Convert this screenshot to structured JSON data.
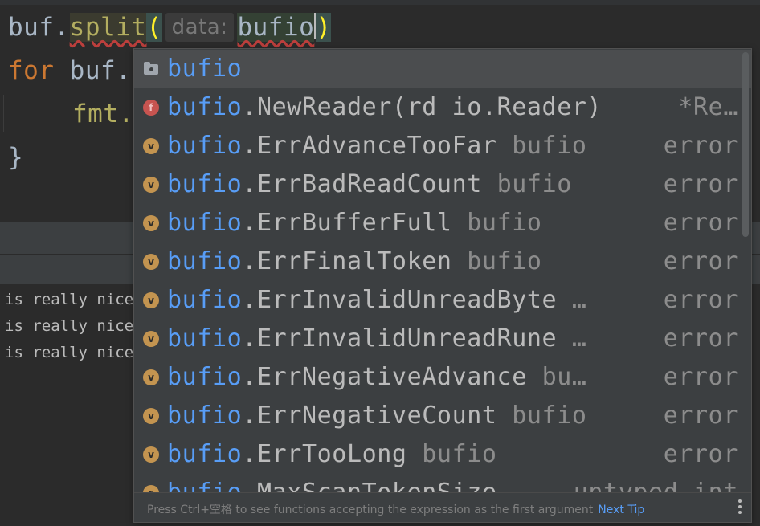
{
  "editor": {
    "line1": {
      "obj": "buf.",
      "method": "split",
      "open_paren": "(",
      "hint": "data:",
      "typed": "bufio",
      "close_paren": ")"
    },
    "line2": {
      "keyword": "for",
      "rest": " buf."
    },
    "line3": {
      "rest": "fmt."
    },
    "line4": {
      "brace": "}"
    }
  },
  "console": {
    "lines": [
      "is really nice",
      "is really nice",
      "is really nice"
    ]
  },
  "completion": {
    "items": [
      {
        "icon": "package-icon",
        "prefix": "bufio",
        "name": "",
        "pkg": "",
        "type": ""
      },
      {
        "icon": "function-icon",
        "prefix": "bufio",
        "name": ".NewReader(rd io.Reader)",
        "pkg": "",
        "type": "*Re…"
      },
      {
        "icon": "variable-icon",
        "prefix": "bufio",
        "name": ".ErrAdvanceTooFar",
        "pkg": "bufio",
        "type": "error"
      },
      {
        "icon": "variable-icon",
        "prefix": "bufio",
        "name": ".ErrBadReadCount",
        "pkg": "bufio",
        "type": "error"
      },
      {
        "icon": "variable-icon",
        "prefix": "bufio",
        "name": ".ErrBufferFull",
        "pkg": "bufio",
        "type": "error"
      },
      {
        "icon": "variable-icon",
        "prefix": "bufio",
        "name": ".ErrFinalToken",
        "pkg": "bufio",
        "type": "error"
      },
      {
        "icon": "variable-icon",
        "prefix": "bufio",
        "name": ".ErrInvalidUnreadByte",
        "pkg": "…",
        "type": "error"
      },
      {
        "icon": "variable-icon",
        "prefix": "bufio",
        "name": ".ErrInvalidUnreadRune",
        "pkg": "…",
        "type": "error"
      },
      {
        "icon": "variable-icon",
        "prefix": "bufio",
        "name": ".ErrNegativeAdvance",
        "pkg": "bu…",
        "type": "error"
      },
      {
        "icon": "variable-icon",
        "prefix": "bufio",
        "name": ".ErrNegativeCount",
        "pkg": "bufio",
        "type": "error"
      },
      {
        "icon": "variable-icon",
        "prefix": "bufio",
        "name": ".ErrTooLong",
        "pkg": "bufio",
        "type": "error"
      },
      {
        "icon": "constant-icon",
        "prefix": "bufio",
        "name": ".MaxScanTokenSize",
        "pkg": "",
        "type": "untyped int"
      }
    ],
    "footer_tip": "Press Ctrl+空格 to see functions accepting the expression as the first argument",
    "footer_link": "Next Tip"
  },
  "colors": {
    "background": "#2b2b2b",
    "popup": "#3c3f41",
    "match": "#589df6",
    "keyword": "#cc7832",
    "method": "#b3ae60",
    "field_icon": "#c39450",
    "function_icon": "#c75450"
  }
}
